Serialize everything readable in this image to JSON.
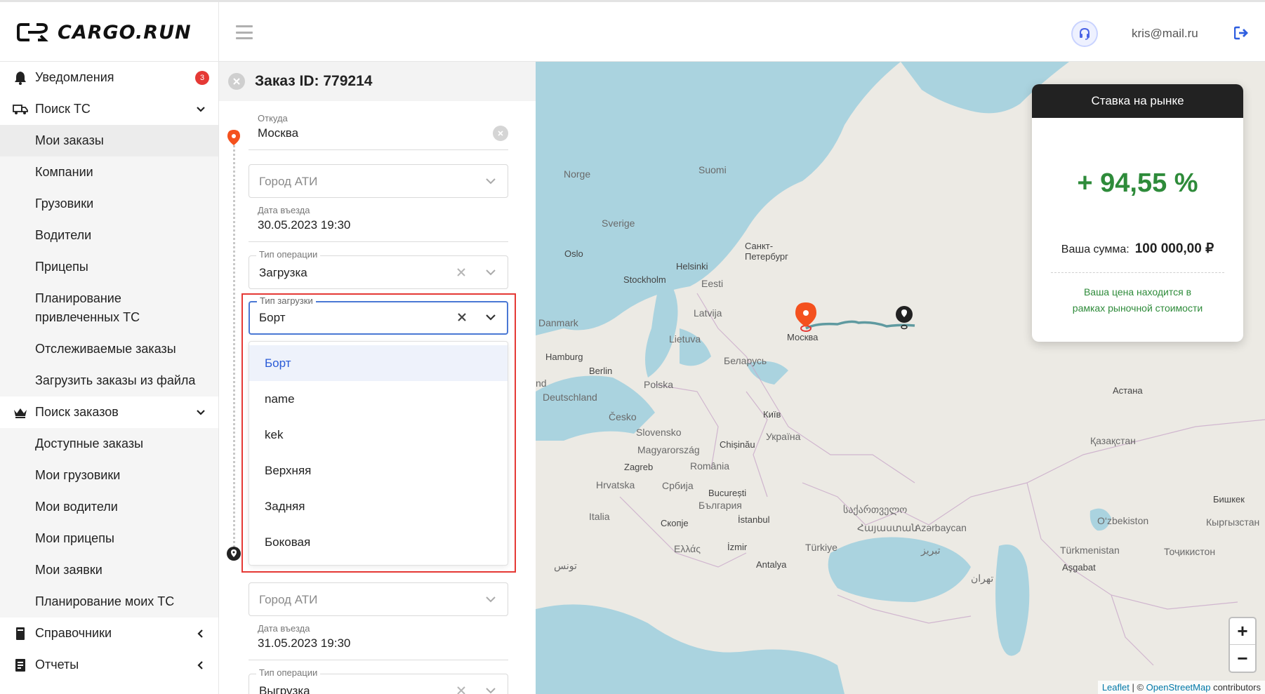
{
  "brand": {
    "name": "CARGO.RUN"
  },
  "header": {
    "user_email": "kris@mail.ru"
  },
  "sidebar": {
    "notifications": {
      "label": "Уведомления",
      "count": "3"
    },
    "search_vehicles": {
      "label": "Поиск ТС",
      "items": [
        "Мои заказы",
        "Компании",
        "Грузовики",
        "Водители",
        "Прицепы",
        "Планирование привлеченных ТС",
        "Отслеживаемые заказы",
        "Загрузить заказы из файла"
      ]
    },
    "search_orders": {
      "label": "Поиск заказов",
      "items": [
        "Доступные заказы",
        "Мои грузовики",
        "Мои водители",
        "Мои прицепы",
        "Мои заявки",
        "Планирование моих ТС"
      ]
    },
    "references": {
      "label": "Справочники"
    },
    "reports": {
      "label": "Отчеты"
    }
  },
  "order": {
    "title": "Заказ ID: 779214",
    "from": {
      "label": "Откуда",
      "value": "Москва"
    },
    "city_ati_placeholder": "Город АТИ",
    "entry_date_1": {
      "label": "Дата въезда",
      "value": "30.05.2023 19:30"
    },
    "operation_type_1": {
      "label": "Тип операции",
      "value": "Загрузка"
    },
    "loading_type": {
      "label": "Тип загрузки",
      "value": "Борт",
      "options": [
        "Борт",
        "name",
        "kek",
        "Верхняя",
        "Задняя",
        "Боковая"
      ]
    },
    "entry_date_2": {
      "label": "Дата въезда",
      "value": "31.05.2023 19:30"
    },
    "operation_type_2": {
      "label": "Тип операции",
      "value": "Выгрузка"
    }
  },
  "map": {
    "labels": {
      "norge": "Norge",
      "suomi": "Suomi",
      "sverige": "Sverige",
      "oslo": "Oslo",
      "helsinki": "Helsinki",
      "spb": "Санкт-Петербург",
      "stockholm": "Stockholm",
      "eesti": "Eesti",
      "latvija": "Latvija",
      "danmark": "Danmark",
      "lietuva": "Lietuva",
      "moskva": "Москва",
      "hamburg": "Hamburg",
      "berlin": "Berlin",
      "belarus": "Беларусь",
      "polska": "Polska",
      "nd": "nd",
      "deutschland": "Deutschland",
      "cesko": "Česko",
      "kyiv": "Київ",
      "slovensko": "Slovensko",
      "ukraina": "Україна",
      "magyarorszag": "Magyarország",
      "chisinau": "Chișinău",
      "zagreb": "Zagreb",
      "romania": "România",
      "hrvatska": "Hrvatska",
      "srbija": "Србија",
      "bucuresti": "București",
      "bulgaria": "България",
      "italia": "Italia",
      "skopje": "Скопје",
      "istanbul": "İstanbul",
      "sakartvelo": "საქართველო",
      "hayastan": "Հայաստան",
      "azerbaycan": "Azərbaycan",
      "ellada": "Ελλάς",
      "izmir": "İzmir",
      "turkiye": "Türkiye",
      "tebriz": "تبریز",
      "antalya": "Antalya",
      "tunis": "تونس",
      "tehran": "تهران",
      "astana": "Астана",
      "kazakhstan": "Қазақстан",
      "bishkek": "Бишкек",
      "ozbekiston": "O‘zbekiston",
      "kyrgyzstan": "Кыргызстан",
      "turkmenistan": "Türkmenistan",
      "tojikiston": "Тоҷикистон",
      "ashgabat": "Aşgabat"
    },
    "attribution": {
      "leaflet": "Leaflet",
      "osm": "OpenStreetMap",
      "contributors": "contributors"
    },
    "zoom_in": "+",
    "zoom_out": "−"
  },
  "market": {
    "title": "Ставка на рынке",
    "percent": "+ 94,55 %",
    "sum_label": "Ваша сумма:",
    "sum_value": "100 000,00 ₽",
    "note_line1": "Ваша цена находится в",
    "note_line2": "рамках рыночной стоимости"
  }
}
